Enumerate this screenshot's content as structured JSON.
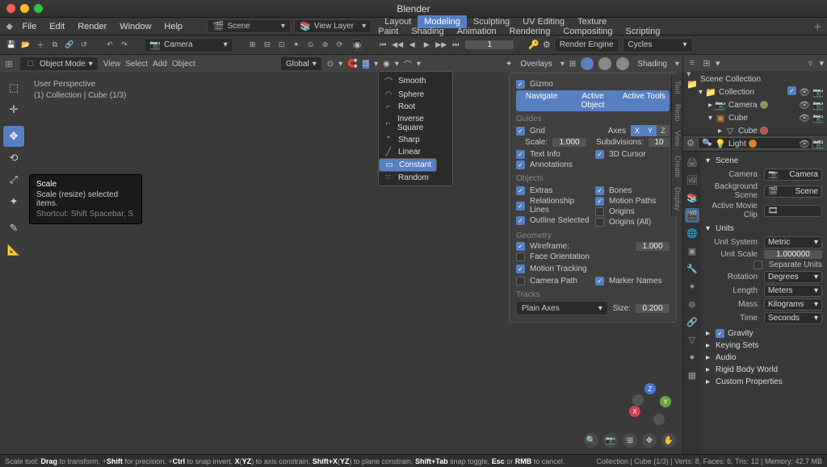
{
  "app_title": "Blender",
  "menubar": [
    "File",
    "Edit",
    "Render",
    "Window",
    "Help"
  ],
  "scene_label": "Scene",
  "viewlayer_label": "View Layer",
  "workspace_tabs": [
    "Layout",
    "Modeling",
    "Sculpting",
    "UV Editing",
    "Texture Paint",
    "Shading",
    "Animation",
    "Rendering",
    "Compositing",
    "Scripting"
  ],
  "workspace_active": "Modeling",
  "render_engine_label": "Render Engine",
  "render_engine_value": "Cycles",
  "camera_drop": "Camera",
  "frame_current": "1",
  "vp_header": {
    "mode": "Object Mode",
    "menus": [
      "View",
      "Select",
      "Add",
      "Object"
    ],
    "orientation": "Global",
    "overlays_label": "Overlays",
    "shading_label": "Shading"
  },
  "viewport_info": {
    "line1": "User Perspective",
    "line2": "(1) Collection | Cube (1/3)"
  },
  "tooltip": {
    "title": "Scale",
    "desc": "Scale (resize) selected items.",
    "shortcut": "Shortcut: Shift Spacebar, S"
  },
  "falloff": {
    "items": [
      "Smooth",
      "Sphere",
      "Root",
      "Inverse Square",
      "Sharp",
      "Linear",
      "Constant",
      "Random"
    ],
    "selected": "Constant"
  },
  "gizmo_axes": [
    "X",
    "Y",
    "Z"
  ],
  "overlay": {
    "gizmo": "Gizmo",
    "tabs": [
      "Navigate",
      "Active Object",
      "Active Tools"
    ],
    "guides": "Guides",
    "grid": "Grid",
    "axes_lbl": "Axes",
    "scale_lbl": "Scale:",
    "scale_val": "1.000",
    "subdiv_lbl": "Subdivisions:",
    "subdiv_val": "10",
    "text_info": "Text Info",
    "cursor3d": "3D Cursor",
    "annotations": "Annotations",
    "objects": "Objects",
    "extras": "Extras",
    "bones": "Bones",
    "rel_lines": "Relationship Lines",
    "motion_paths": "Motion Paths",
    "outline_sel": "Outline Selected",
    "origins": "Origins",
    "origins_all": "Origins (All)",
    "geometry": "Geometry",
    "wireframe_lbl": "Wireframe:",
    "wireframe_val": "1.000",
    "face_orient": "Face Orientation",
    "motion_tracking": "Motion Tracking",
    "camera_path": "Camera Path",
    "marker_names": "Marker Names",
    "tracks": "Tracks",
    "plain_axes": "Plain Axes",
    "size_lbl": "Size:",
    "size_val": "0.200"
  },
  "sidebar_tabs": [
    "Tool",
    "Redo",
    "View",
    "Create",
    "Display"
  ],
  "outliner": {
    "root": "Scene Collection",
    "collection": "Collection",
    "camera": "Camera",
    "cube": "Cube",
    "cube2": "Cube",
    "light": "Light"
  },
  "props": {
    "scene_h": "Scene",
    "camera_lbl": "Camera",
    "camera_val": "Camera",
    "bg_scene_lbl": "Background Scene",
    "bg_scene_val": "Scene",
    "active_clip_lbl": "Active Movie Clip",
    "units_h": "Units",
    "unit_system_lbl": "Unit System",
    "unit_system_val": "Metric",
    "unit_scale_lbl": "Unit Scale",
    "unit_scale_val": "1.000000",
    "separate_units": "Separate Units",
    "rotation_lbl": "Rotation",
    "rotation_val": "Degrees",
    "length_lbl": "Length",
    "length_val": "Meters",
    "mass_lbl": "Mass",
    "mass_val": "Kilograms",
    "time_lbl": "Time",
    "time_val": "Seconds",
    "gravity_h": "Gravity",
    "keying_h": "Keying Sets",
    "audio_h": "Audio",
    "rigid_h": "Rigid Body World",
    "custom_h": "Custom Properties"
  },
  "status": {
    "left_html": "Scale tool: <b>Drag</b> to transform, +<b>Shift</b> for precision, +<b>Ctrl</b> to snap invert, <b>X</b>(<b>YZ</b>) to axis constrain, <b>Shift+X</b>(<b>YZ</b>) to plane constrain, <b>Shift+Tab</b> snap toggle, <b>Esc</b> or <b>RMB</b> to cancel.",
    "right": "Collection | Cube (1/3)  |  Verts: 8, Faces: 6, Tris: 12  |  Memory: 42.7 MB"
  }
}
